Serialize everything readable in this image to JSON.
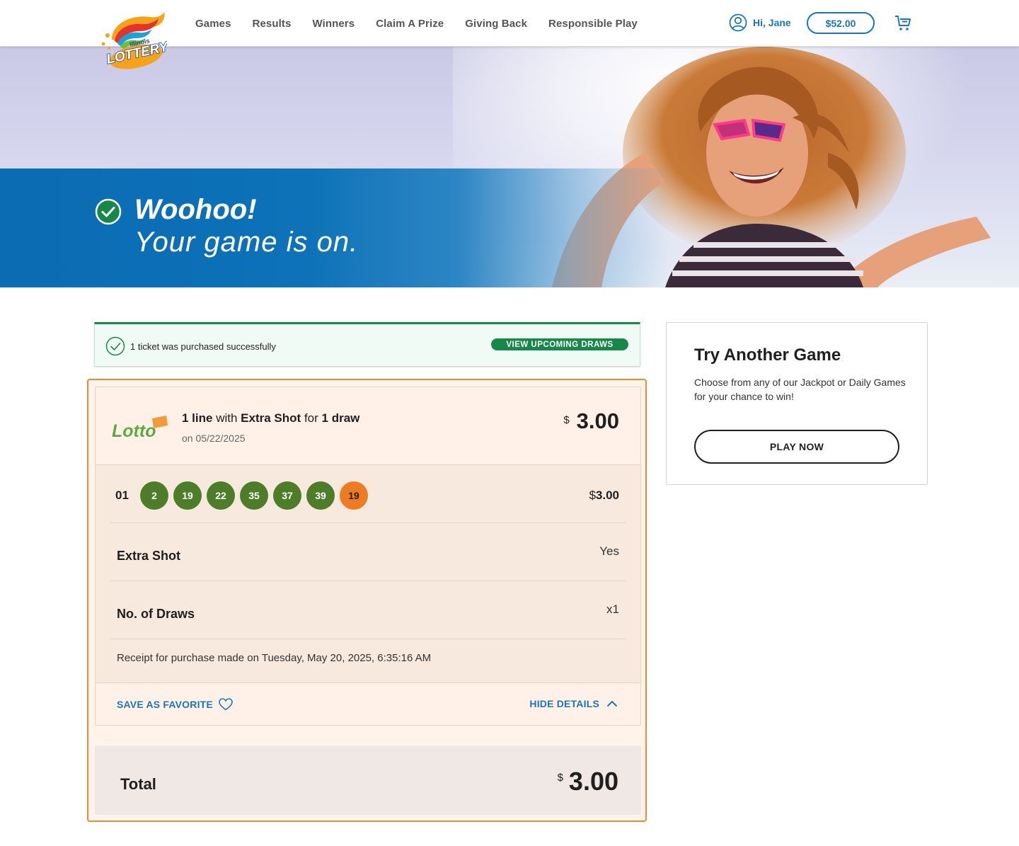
{
  "header": {
    "logo_top": "Illinois",
    "logo_main": "LOTTERY",
    "nav": [
      "Games",
      "Results",
      "Winners",
      "Claim A Prize",
      "Giving Back",
      "Responsible Play"
    ],
    "greeting": "Hi, Jane",
    "balance": "$52.00"
  },
  "hero": {
    "title": "Woohoo!",
    "subtitle": "Your game is on."
  },
  "success": {
    "message": "1 ticket was purchased successfully",
    "button": "VIEW UPCOMING DRAWS"
  },
  "order": {
    "game_logo": "Lotto",
    "summary": {
      "lines": "1 line",
      "with": "with",
      "addon": "Extra Shot",
      "for": "for",
      "draws": "1 draw"
    },
    "draw_date": "on 05/22/2025",
    "currency": "$",
    "price": "3.00",
    "line": {
      "number": "01",
      "balls": [
        "2",
        "19",
        "22",
        "35",
        "37",
        "39"
      ],
      "extra_ball": "19",
      "price_symbol": "$",
      "price": "3.00"
    },
    "extra_shot_label": "Extra Shot",
    "extra_shot_value": "Yes",
    "draws_label": "No. of Draws",
    "draws_value": "x1",
    "receipt": "Receipt for purchase made on Tuesday, May 20, 2025, 6:35:16 AM",
    "save_favorite": "SAVE AS FAVORITE",
    "hide_details": "HIDE DETAILS",
    "total_label": "Total",
    "total_currency": "$",
    "total_amount": "3.00"
  },
  "side": {
    "title": "Try Another Game",
    "text": "Choose from any of our Jackpot or Daily Games for your chance to win!",
    "button": "PLAY NOW"
  },
  "colors": {
    "accent_blue": "#1a76bb",
    "success_green": "#17874a",
    "ball_green": "#4e7d2a",
    "ball_orange": "#ed7b22",
    "panel_border": "#e88a37"
  }
}
